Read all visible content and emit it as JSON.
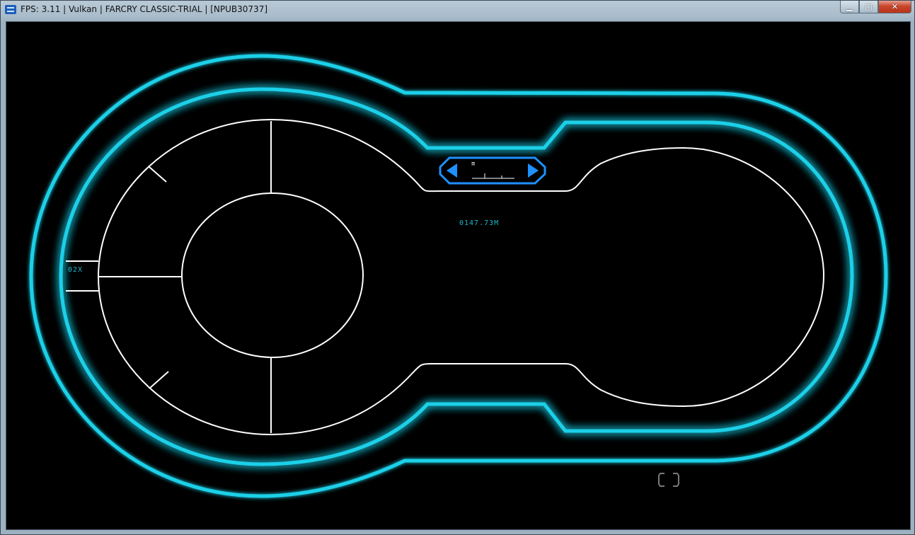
{
  "window": {
    "title": "FPS: 3.11 | Vulkan | FARCRY CLASSIC-TRIAL | [NPUB30737]",
    "minimize_label": "▁",
    "maximize_label": "▢",
    "close_label": "✕"
  },
  "hud": {
    "distance_readout": "0147.73M",
    "zoom_readout": "02X",
    "compass_marker": "≡",
    "colors": {
      "glow": "#1fd0e8",
      "outline": "#ffffff",
      "arrow": "#1e90ff",
      "text": "#1fb7cf"
    },
    "icons": {
      "left_arrow": "left-arrow-icon",
      "right_arrow": "right-arrow-icon",
      "bracket": "bracket-icon"
    }
  }
}
